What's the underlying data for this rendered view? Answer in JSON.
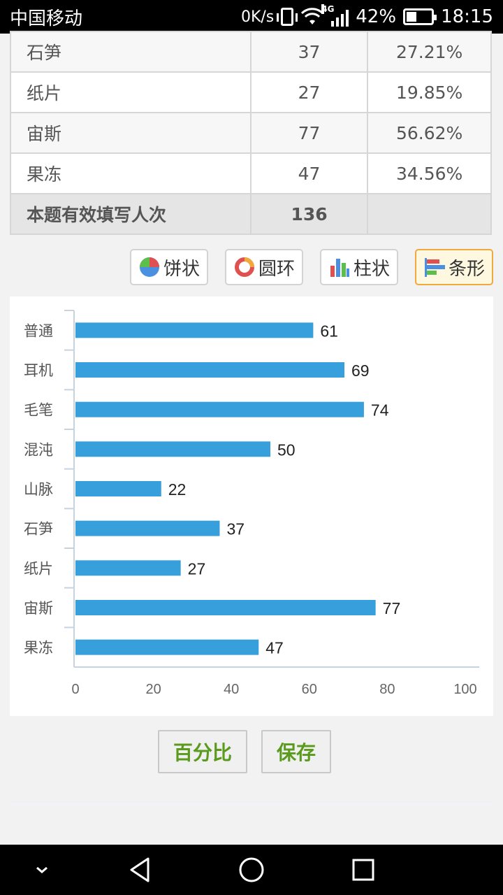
{
  "status_bar": {
    "carrier": "中国移动",
    "net_speed": "0K/s",
    "network_type": "4G",
    "battery": "42%",
    "time": "18:15"
  },
  "table": {
    "rows": [
      {
        "name": "石笋",
        "count": "37",
        "pct": "27.21%"
      },
      {
        "name": "纸片",
        "count": "27",
        "pct": "19.85%"
      },
      {
        "name": "宙斯",
        "count": "77",
        "pct": "56.62%"
      },
      {
        "name": "果冻",
        "count": "47",
        "pct": "34.56%"
      }
    ],
    "total_label": "本题有效填写人次",
    "total_value": "136",
    "total_pct": ""
  },
  "chart_types": [
    {
      "label": "饼状",
      "icon": "pie-chart-icon",
      "active": false
    },
    {
      "label": "圆环",
      "icon": "ring-chart-icon",
      "active": false
    },
    {
      "label": "柱状",
      "icon": "column-chart-icon",
      "active": false
    },
    {
      "label": "条形",
      "icon": "bar-chart-icon",
      "active": true
    }
  ],
  "chart_data": {
    "type": "bar",
    "orientation": "horizontal",
    "categories": [
      "普通",
      "耳机",
      "毛笔",
      "混沌",
      "山脉",
      "石笋",
      "纸片",
      "宙斯",
      "果冻"
    ],
    "values": [
      61,
      69,
      74,
      50,
      22,
      37,
      27,
      77,
      47
    ],
    "xlim": [
      0,
      100
    ],
    "x_ticks": [
      0,
      20,
      40,
      60,
      80,
      100
    ],
    "bar_color": "#37a0dc",
    "data_labels": true,
    "grid": false
  },
  "actions": {
    "percent_label": "百分比",
    "save_label": "保存"
  },
  "colors": {
    "accent_green": "#5a9a1c",
    "active_border": "#f0a93c"
  }
}
